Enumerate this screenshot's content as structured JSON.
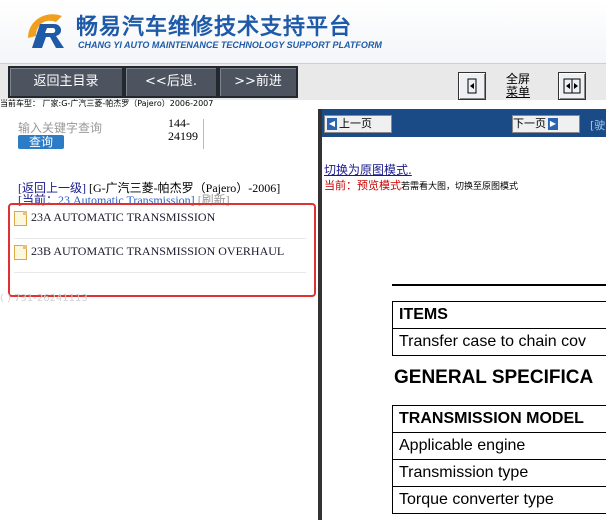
{
  "header": {
    "title_cn": "畅易汽车维修技术支持平台",
    "title_en": "CHANG YI AUTO MAINTENANCE TECHNOLOGY SUPPORT PLATFORM"
  },
  "toolbar": {
    "home_label": "返回主目录",
    "back_label": "<<后退.",
    "forward_label": ">>前进",
    "fullscreen_line1": "全屏",
    "fullscreen_line2": "菜单"
  },
  "car_info": "当前车型：  厂家:G-广汽三菱-帕杰罗（Pajero）2006-2007",
  "sidebar": {
    "search_placeholder": "输入关键字查询",
    "search_button": "查询",
    "code_line1": "144-",
    "code_line2": "24199",
    "breadcrumb_back": "[返回上一级]",
    "breadcrumb_path": "[G-广汽三菱-帕杰罗（Pajero）-2006]",
    "current_prefix": "[当前：",
    "current_value": "23 Automatic Transmission]",
    "refresh": "[刷新]",
    "items": [
      {
        "label": "23A AUTOMATIC TRANSMISSION"
      },
      {
        "label": "23B AUTOMATIC TRANSMISSION OVERHAUL"
      }
    ],
    "ghost_text": "( ) 731-26241113"
  },
  "viewer": {
    "prev_page": "上一页",
    "next_page": "下一页",
    "bar_extra": "[驶",
    "switch_mode_link": "切换为原图模式.",
    "current_mode_label": "当前：",
    "current_mode_value": "预览模式",
    "current_mode_hint": "若需看大图，切换至原图模式",
    "doc": {
      "items_header": "ITEMS",
      "items_row": "Transfer case to chain cov",
      "section_title": "GENERAL SPECIFICA",
      "spec_header": "TRANSMISSION MODEL",
      "spec_rows": [
        "Applicable engine",
        "Transmission type",
        "Torque converter type"
      ]
    }
  }
}
